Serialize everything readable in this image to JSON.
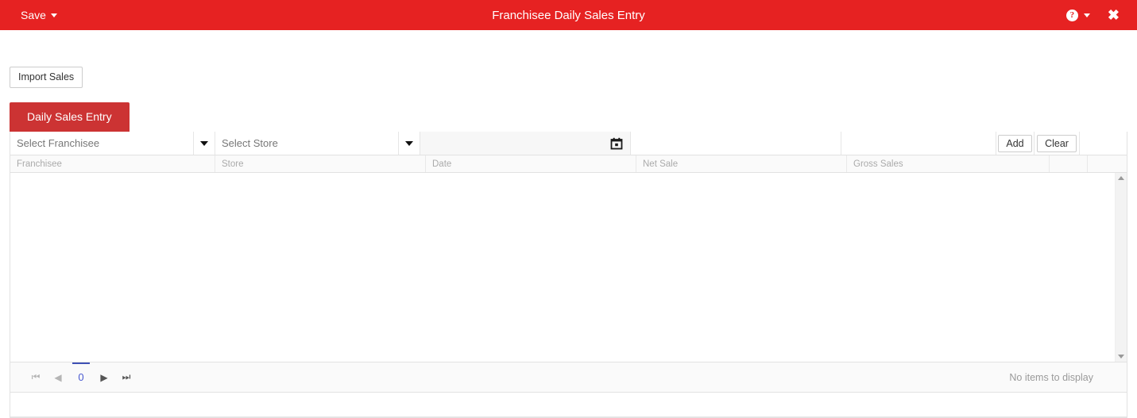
{
  "appbar": {
    "save_label": "Save",
    "title": "Franchisee Daily Sales Entry",
    "help_glyph": "?",
    "close_glyph": "✖"
  },
  "toolbar": {
    "import_label": "Import Sales"
  },
  "tabs": [
    {
      "label": "Daily Sales Entry",
      "active": true
    }
  ],
  "form": {
    "franchisee_placeholder": "Select Franchisee",
    "store_placeholder": "Select Store",
    "date_value": "",
    "amount_value": "",
    "add_label": "Add",
    "clear_label": "Clear"
  },
  "table": {
    "columns": [
      "Franchisee",
      "Store",
      "Date",
      "Net Sale",
      "Gross Sales"
    ],
    "rows": [],
    "empty_text": "No items to display"
  },
  "pager": {
    "first_glyph": "⏮",
    "prev_glyph": "◀",
    "page_number": "0",
    "next_glyph": "▶",
    "last_glyph": "⏭"
  },
  "colors": {
    "appbar_red": "#e62222",
    "tab_red": "#cc3333",
    "pager_accent": "#3f51b5"
  }
}
